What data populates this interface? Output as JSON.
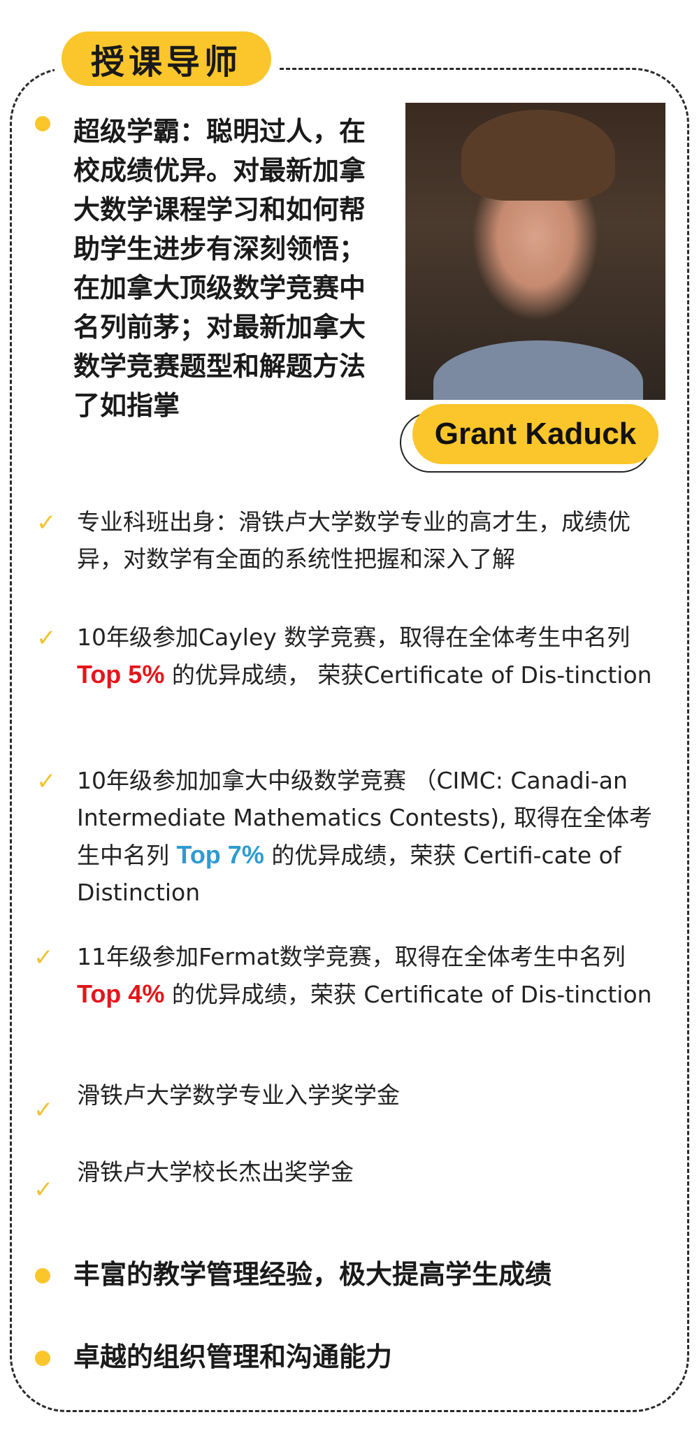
{
  "section_title": "授课导师",
  "intro_text": "超级学霸：聪明过人，在校成绩优异。对最新加拿大数学课程学习和如何帮助学生进步有深刻领悟；在加拿大顶级数学竞赛中名列前茅；对最新加拿大数学竞赛题型和解题方法了如指掌",
  "tutor_name": "Grant Kaduck",
  "check_icon": "✓",
  "items": [
    {
      "before": "专业科班出身：滑铁卢大学数学专业的高才生，成绩优异，对数学有全面的系统性把握和深入了解",
      "highlight": "",
      "after": ""
    },
    {
      "before": "10年级参加Cayley 数学竞赛，取得在全体考生中名列 ",
      "highlight": "Top 5%",
      "after": " 的优异成绩， 荣获Certificate of Dis-tinction"
    },
    {
      "before": "10年级参加加拿大中级数学竞赛 （CIMC: Canadi-an Intermediate Mathematics Contests), 取得在全体考生中名列 ",
      "highlight": "Top 7%",
      "after": " 的优异成绩，荣获 Certifi-cate of  Distinction"
    },
    {
      "before": "11年级参加Fermat数学竞赛，取得在全体考生中名列 ",
      "highlight": "Top 4%",
      "after": " 的优异成绩，荣获 Certificate of  Dis-tinction"
    },
    {
      "before": "滑铁卢大学数学专业入学奖学金",
      "highlight": "",
      "after": ""
    },
    {
      "before": "滑铁卢大学校长杰出奖学金",
      "highlight": "",
      "after": ""
    }
  ],
  "bullet_points": [
    "丰富的教学管理经验，极大提高学生成绩",
    "卓越的组织管理和沟通能力"
  ],
  "colors": {
    "accent_yellow": "#fbc62b",
    "highlight_red": "#e3161b",
    "highlight_blue": "#2e9bd0"
  }
}
